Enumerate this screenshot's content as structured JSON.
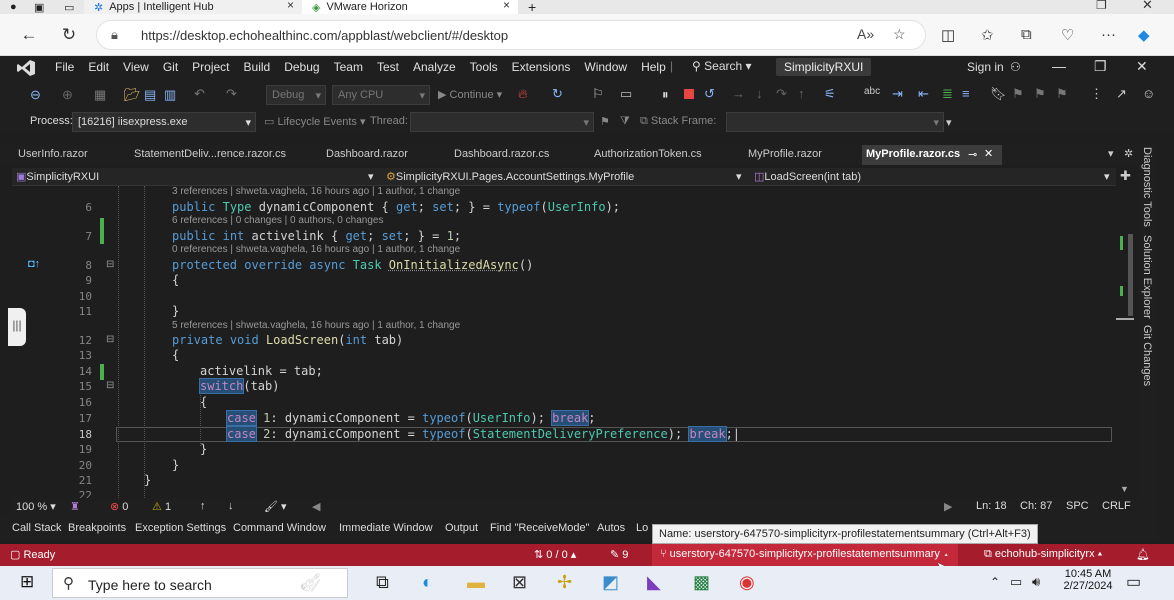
{
  "browser": {
    "tabs": [
      {
        "label": "Apps | Intelligent Hub"
      },
      {
        "label": "VMware Horizon"
      }
    ],
    "new_tab": "+",
    "url": "https://desktop.echohealthinc.com/appblast/webclient/#/desktop"
  },
  "vs": {
    "menu": [
      "File",
      "Edit",
      "View",
      "Git",
      "Project",
      "Build",
      "Debug",
      "Team",
      "Test",
      "Analyze",
      "Tools",
      "Extensions",
      "Window",
      "Help"
    ],
    "search_label": "Search",
    "solution_name": "SimplicityRXUI",
    "signin": "Sign in",
    "toolbar": {
      "config": "Debug",
      "platform": "Any CPU",
      "continue": "Continue"
    },
    "toolbar2": {
      "process_label": "Process:",
      "process_value": "[16216] iisexpress.exe",
      "lifecycle": "Lifecycle Events",
      "thread_label": "Thread:",
      "stack_label": "Stack Frame:"
    },
    "doc_tabs": [
      "UserInfo.razor",
      "StatementDeliv...rence.razor.cs",
      "Dashboard.razor",
      "Dashboard.razor.cs",
      "AuthorizationToken.cs",
      "MyProfile.razor",
      "MyProfile.razor.cs"
    ],
    "navbar": {
      "project": "SimplicityRXUI",
      "class": "SimplicityRXUI.Pages.AccountSettings.MyProfile",
      "member": "LoadScreen(int tab)"
    },
    "code": {
      "lines": [
        "6",
        "7",
        "8",
        "9",
        "10",
        "11",
        "12",
        "13",
        "14",
        "15",
        "16",
        "17",
        "18",
        "19",
        "20",
        "21",
        "22"
      ],
      "lens1": "3 references | shweta.vaghela, 16 hours ago | 1 author, 1 change",
      "lens2": "6 references | 0 changes | 0 authors, 0 changes",
      "lens3": "0 references | shweta.vaghela, 16 hours ago | 1 author, 1 change",
      "lens4": "5 references | shweta.vaghela, 16 hours ago | 1 author, 1 change"
    },
    "right_panels": [
      "Diagnostic Tools",
      "Solution Explorer",
      "Git Changes"
    ],
    "editor_status": {
      "zoom": "100 %",
      "errors": "0",
      "warnings": "1",
      "line": "Ln: 18",
      "col": "Ch: 87",
      "spc": "SPC",
      "crlf": "CRLF"
    },
    "bottom_tabs": [
      "Call Stack",
      "Breakpoints",
      "Exception Settings",
      "Command Window",
      "Immediate Window",
      "Output",
      "Find \"ReceiveMode\"",
      "Autos",
      "Lo"
    ],
    "tooltip": "Name: userstory-647570-simplicityrx-profilestatementsummary (Ctrl+Alt+F3)",
    "status": {
      "ready": "Ready",
      "sync": "0 / 0",
      "pending": "9",
      "branch": "userstory-647570-simplicityrx-profilestatementsummary",
      "repo": "echohub-simplicityrx"
    }
  },
  "taskbar": {
    "search_placeholder": "Type here to search",
    "time": "10:45 AM",
    "date": "2/27/2024"
  }
}
